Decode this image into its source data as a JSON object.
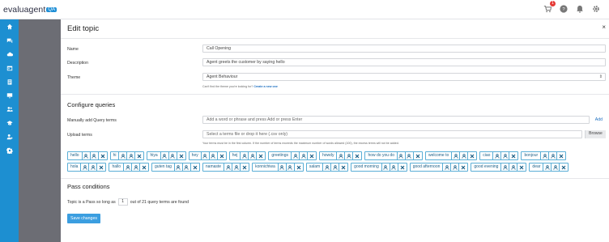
{
  "topbar": {
    "logo_text": "evaluagent",
    "logo_mark": "QA",
    "notification_count": "1",
    "icons": [
      "cart-icon",
      "help-icon",
      "bell-icon",
      "gear-icon"
    ]
  },
  "nav": {
    "icons": [
      "home-icon",
      "chat-icon",
      "cloud-icon",
      "calendar-icon",
      "clipboard-icon",
      "monitor-icon",
      "users-icon",
      "graduation-icon",
      "user-settings-icon",
      "gear-icon"
    ]
  },
  "panel": {
    "title": "Edit topic",
    "close": "×"
  },
  "form": {
    "name_label": "Name",
    "name_value": "Call Opening",
    "description_label": "Description",
    "description_value": "Agent greets the customer by saying hello",
    "theme_label": "Theme",
    "theme_value": "Agent Behaviour",
    "theme_hint": "Can't find the theme you're looking for?",
    "theme_hint_link": "Create a new one"
  },
  "queries": {
    "heading": "Configure queries",
    "manual_label": "Manually add Query terms",
    "manual_placeholder": "Add a word or phrase and press Add or press Enter",
    "add_label": "Add",
    "upload_label": "Upload terms",
    "upload_placeholder": "Select a terms file or drop it here (.csv only)",
    "browse_label": "Browse",
    "upload_hint": "Your terms must be in the first column. If the number of terms exceeds the maximum number of words allowed (100), the excess terms will not be added.",
    "terms": [
      "hello",
      "hi",
      "hiya",
      "hey",
      "hej",
      "greetings",
      "howdy",
      "how do you do",
      "welcome to",
      "ciao",
      "bonjour",
      "hola",
      "hallo",
      "guten tag",
      "namaste",
      "konnichiwa",
      "salam",
      "good morning",
      "good afternoon",
      "good evening",
      "dear"
    ]
  },
  "pass": {
    "heading": "Pass conditions",
    "prefix": "Topic is a Pass so long as",
    "count": "1",
    "suffix": "out of 21 query terms are found",
    "save_label": "Save changes"
  },
  "colors": {
    "nav_bg": "#1d8fd1",
    "subnav_bg": "#6c6d74",
    "accent": "#3b9ee0",
    "term_border": "#5aaed6"
  }
}
